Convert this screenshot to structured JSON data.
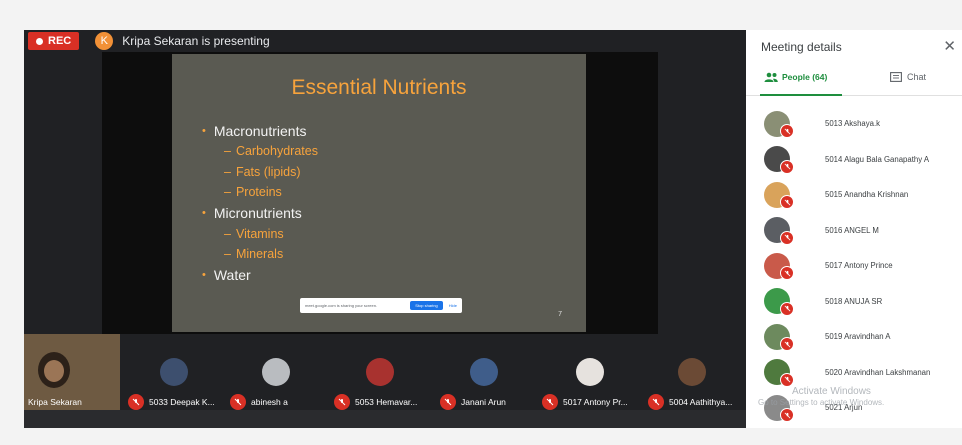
{
  "recording": {
    "label": "REC"
  },
  "presenter": {
    "initial": "K",
    "text": "Kripa Sekaran is presenting"
  },
  "slide": {
    "title": "Essential Nutrients",
    "bullets": [
      {
        "text": "Macronutrients",
        "level": 1
      },
      {
        "text": "Carbohydrates",
        "level": 2
      },
      {
        "text": "Fats (lipids)",
        "level": 2
      },
      {
        "text": "Proteins",
        "level": 2
      },
      {
        "text": "Micronutrients",
        "level": 1
      },
      {
        "text": "Vitamins",
        "level": 2
      },
      {
        "text": "Minerals",
        "level": 2
      },
      {
        "text": "Water",
        "level": 1
      }
    ],
    "page_number": "7",
    "share_bar": {
      "message": "meet.google.com is sharing your screen.",
      "stop_label": "Stop sharing",
      "hide_label": "Hide"
    }
  },
  "self_tile": {
    "name": "Kripa Sekaran"
  },
  "participants": [
    {
      "name": "5033 Deepak K...",
      "avatar_color": "#3d4f6e"
    },
    {
      "name": "abinesh a",
      "avatar_color": "#b9bcc0"
    },
    {
      "name": "5053 Hemavar...",
      "avatar_color": "#a8322f"
    },
    {
      "name": "Janani Arun",
      "avatar_color": "#3f5d8a"
    },
    {
      "name": "5017 Antony Pr...",
      "avatar_color": "#e6e2de"
    },
    {
      "name": "5004 Aathithya...",
      "avatar_color": "#6b4a35"
    }
  ],
  "sidebar": {
    "title": "Meeting details",
    "tab_people": "People (64)",
    "tab_chat": "Chat",
    "people": [
      {
        "name": "5013 Akshaya.k",
        "avatar_color": "#8a8f75"
      },
      {
        "name": "5014 Alagu Bala Ganapathy A",
        "avatar_color": "#4a4a4a"
      },
      {
        "name": "5015 Anandha Krishnan",
        "avatar_color": "#d9a35b"
      },
      {
        "name": "5016 ANGEL M",
        "avatar_color": "#5b5e63"
      },
      {
        "name": "5017 Antony Prince",
        "avatar_color": "#c95a4a"
      },
      {
        "name": "5018 ANUJA SR",
        "avatar_color": "#3c9a4a"
      },
      {
        "name": "5019 Aravindhan A",
        "avatar_color": "#6d8a5e"
      },
      {
        "name": "5020 Aravindhan Lakshmanan",
        "avatar_color": "#4f7a3e"
      },
      {
        "name": "5021 Arjun",
        "avatar_color": "#8a8a8a"
      }
    ]
  },
  "watermark": {
    "line1": "Activate Windows",
    "line2": "Go to Settings to activate Windows."
  },
  "colors": {
    "accent_green": "#1e8e3e",
    "rec_red": "#d93025",
    "slide_orange": "#f7a33c"
  }
}
